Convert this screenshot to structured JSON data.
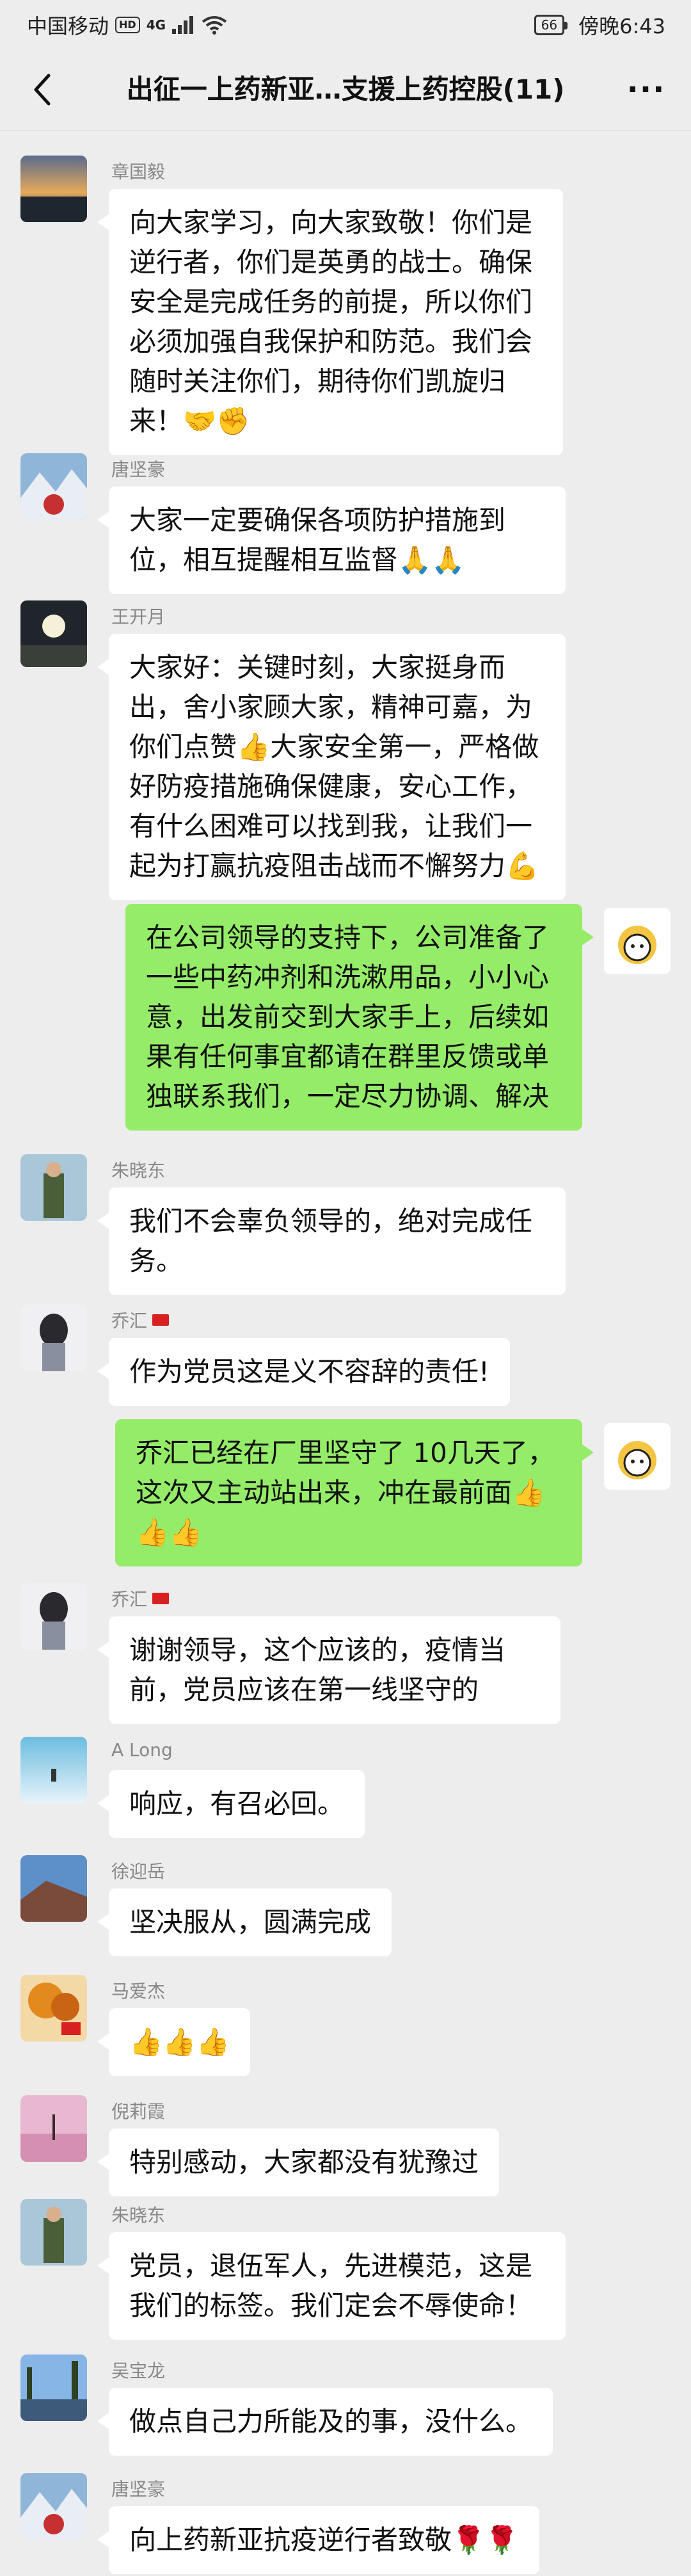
{
  "status_bar": {
    "carrier": "中国移动",
    "hd": "HD",
    "signal": "4G",
    "battery": "66",
    "time": "傍晚6:43"
  },
  "header": {
    "title": "出征一上药新亚…支援上药控股(11)",
    "more": "···"
  },
  "messages": [
    {
      "sender": "章国毅",
      "text": "向大家学习，向大家致敬！你们是逆行者，你们是英勇的战士。确保安全是完成任务的前提，所以你们必须加强自我保护和防范。我们会随时关注你们，期待你们凯旋归来！🤝✊"
    },
    {
      "sender": "唐坚豪",
      "text": "大家一定要确保各项防护措施到位，相互提醒相互监督🙏🙏"
    },
    {
      "sender": "王开月",
      "text": "大家好：关键时刻，大家挺身而出，舍小家顾大家，精神可嘉，为你们点赞👍大家安全第一，严格做好防疫措施确保健康，安心工作，有什么困难可以找到我，让我们一起为打赢抗疫阻击战而不懈努力💪"
    },
    {
      "sender": "",
      "text": "在公司领导的支持下，公司准备了一些中药冲剂和洗漱用品，小小心意，出发前交到大家手上，后续如果有任何事宜都请在群里反馈或单独联系我们，一定尽力协调、解决"
    },
    {
      "sender": "朱晓东",
      "text": "我们不会辜负领导的，绝对完成任务。"
    },
    {
      "sender": "乔汇",
      "text": "作为党员这是义不容辞的责任!"
    },
    {
      "sender": "",
      "text": "乔汇已经在厂里坚守了 10几天了，这次又主动站出来，冲在最前面👍👍👍"
    },
    {
      "sender": "乔汇",
      "text": "谢谢领导，这个应该的，疫情当前，党员应该在第一线坚守的"
    },
    {
      "sender": "A  Long",
      "text": "响应，有召必回。"
    },
    {
      "sender": "徐迎岳",
      "text": "坚决服从，圆满完成"
    },
    {
      "sender": "马爱杰",
      "text": "👍👍👍"
    },
    {
      "sender": "倪莉霞",
      "text": "特别感动，大家都没有犹豫过"
    },
    {
      "sender": "朱晓东",
      "text": "党员，退伍军人，先进模范，这是我们的标签。我们定会不辱使命！"
    },
    {
      "sender": "吴宝龙",
      "text": "做点自己力所能及的事，没什么。"
    },
    {
      "sender": "唐坚豪",
      "text": "向上药新亚抗疫逆行者致敬🌹🌹"
    }
  ],
  "icons": {
    "back": "chevron-left-icon",
    "more": "more-icon"
  }
}
